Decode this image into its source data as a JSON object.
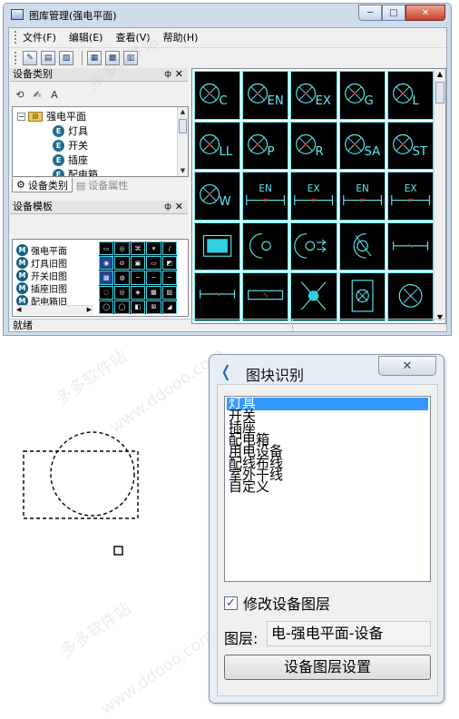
{
  "window": {
    "title": "图库管理(强电平面)",
    "buttons": {
      "minimize": "─",
      "maximize": "□",
      "close": "✕"
    }
  },
  "menu": [
    {
      "label": "文件(F)"
    },
    {
      "label": "编辑(E)"
    },
    {
      "label": "查看(V)"
    },
    {
      "label": "帮助(H)"
    }
  ],
  "category_pane": {
    "title": "设备类别",
    "pin": "ф",
    "close": "✕",
    "tree": {
      "root": "强电平面",
      "children": [
        "灯具",
        "开关",
        "插座",
        "配电箱"
      ]
    },
    "tabs": [
      "设备类别",
      "设备属性"
    ]
  },
  "template_pane": {
    "title": "设备模板",
    "pin": "ф",
    "close": "✕",
    "items": [
      "强电平面",
      "灯具旧图",
      "开关旧图",
      "插座旧图",
      "配电箱旧"
    ]
  },
  "preview": {
    "row1": [
      "C",
      "EN",
      "EX",
      "G",
      "L"
    ],
    "row2": [
      "LL",
      "P",
      "R",
      "SA",
      "ST"
    ],
    "row3": [
      "W",
      "EN",
      "EX",
      "EN",
      "EX"
    ]
  },
  "status": {
    "text": "就绪"
  },
  "dialog": {
    "title": "图块识别",
    "close": "✕",
    "categories": [
      "灯具",
      "开关",
      "插座",
      "配电箱",
      "用电设备",
      "配线布线",
      "室外干线",
      "自定义"
    ],
    "selected_index": 0,
    "checkbox_label": "修改设备图层",
    "checkbox_mark": "✓",
    "checkbox_checked": true,
    "layer_label": "图层:",
    "layer_value": "电-强电平面-设备",
    "layer_button": "设备图层设置"
  },
  "colors": {
    "cad_background": "#000000",
    "cad_line": "#5fe8ee",
    "cad_marker": "#ff2020",
    "selection": "#3399ff"
  }
}
